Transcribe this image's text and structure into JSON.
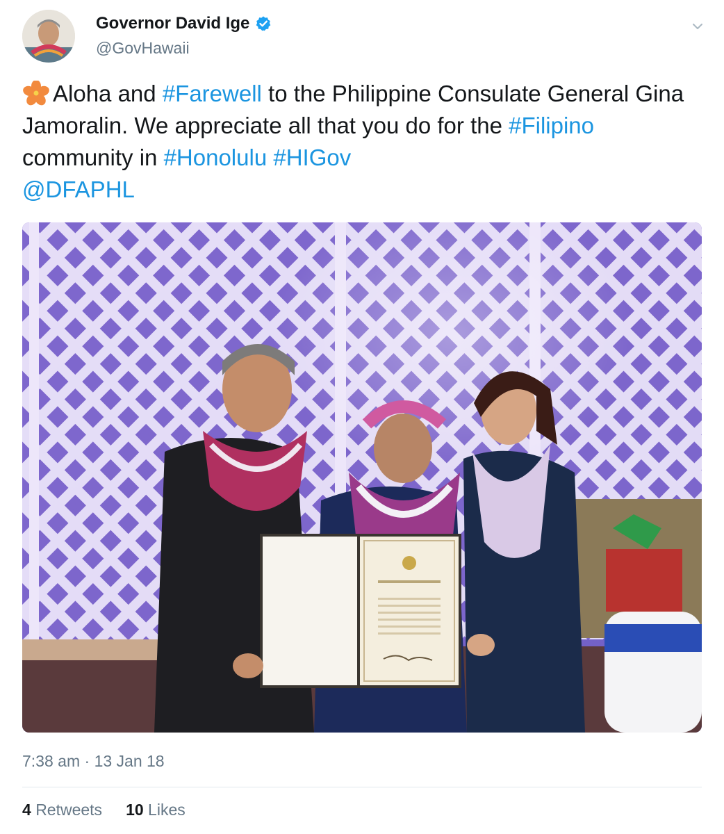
{
  "author": {
    "display_name": "Governor David Ige",
    "handle": "@GovHawaii",
    "verified": true,
    "avatar_icon": "avatar-photo"
  },
  "menu_icon": "chevron-down-icon",
  "tweet": {
    "emoji": "hibiscus-emoji",
    "parts": {
      "p1": "Aloha and ",
      "h1": "#Farewell",
      "p2": " to the Philippine Consulate General Gina Jamoralin. We appreciate all that you do for the ",
      "h2": "#Filipino",
      "p3": " community in ",
      "h3": "#Honolulu",
      "p4": " ",
      "h4": "#HIGov",
      "m1": "@DFAPHL"
    }
  },
  "timestamp": {
    "time": "7:38 am",
    "separator": "·",
    "date": "13 Jan 18"
  },
  "stats": {
    "retweets_count": "4",
    "retweets_label": "Retweets",
    "likes_count": "10",
    "likes_label": "Likes"
  },
  "colors": {
    "link": "#1b95e0",
    "secondary_text": "#657786",
    "verified_badge": "#1da1f2"
  }
}
